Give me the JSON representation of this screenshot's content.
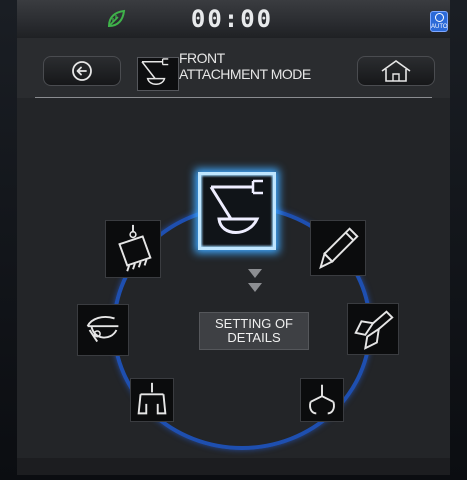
{
  "status_bar": {
    "clock": "00:00",
    "eco_icon": "leaf-icon",
    "eco_color": "#3fb34a",
    "stop_auto_icon": "stop-auto-icon",
    "stop_auto_top": "STOP",
    "stop_auto_bottom": "AUTO",
    "stop_auto_color": "#2c6ad8"
  },
  "header": {
    "back_icon": "back-arrow-icon",
    "home_icon": "home-icon",
    "mode_icon": "front-attachment-icon",
    "title_line1": "FRONT",
    "title_line2": "ATTACHMENT MODE"
  },
  "attachments": [
    {
      "name": "bucket",
      "icon": "bucket-icon",
      "selected": true
    },
    {
      "name": "breaker",
      "icon": "breaker-icon",
      "selected": false
    },
    {
      "name": "crusher",
      "icon": "crusher-icon",
      "selected": false
    },
    {
      "name": "grapple",
      "icon": "grapple-icon",
      "selected": false
    },
    {
      "name": "clamshell",
      "icon": "clamshell-icon",
      "selected": false
    },
    {
      "name": "fork",
      "icon": "fork-icon",
      "selected": false
    },
    {
      "name": "ripper-bucket",
      "icon": "ripper-bucket-icon",
      "selected": false
    }
  ],
  "setting": {
    "line1": "SETTING OF",
    "line2": "DETAILS"
  },
  "colors": {
    "highlight": "#3fa8ff",
    "ring": "#1e4fb0"
  }
}
